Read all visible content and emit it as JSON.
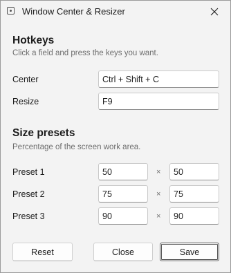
{
  "window": {
    "title": "Window Center & Resizer",
    "icon": "app-window-icon",
    "close_icon": "close-icon"
  },
  "hotkeys": {
    "title": "Hotkeys",
    "subtitle": "Click a field and press the keys you want.",
    "rows": [
      {
        "label": "Center",
        "value": "Ctrl + Shift + C"
      },
      {
        "label": "Resize",
        "value": "F9"
      }
    ]
  },
  "presets": {
    "title": "Size presets",
    "subtitle": "Percentage of the screen work area.",
    "separator": "×",
    "rows": [
      {
        "label": "Preset 1",
        "width": "50",
        "height": "50"
      },
      {
        "label": "Preset 2",
        "width": "75",
        "height": "75"
      },
      {
        "label": "Preset 3",
        "width": "90",
        "height": "90"
      }
    ]
  },
  "buttons": {
    "reset": "Reset",
    "close": "Close",
    "save": "Save"
  }
}
